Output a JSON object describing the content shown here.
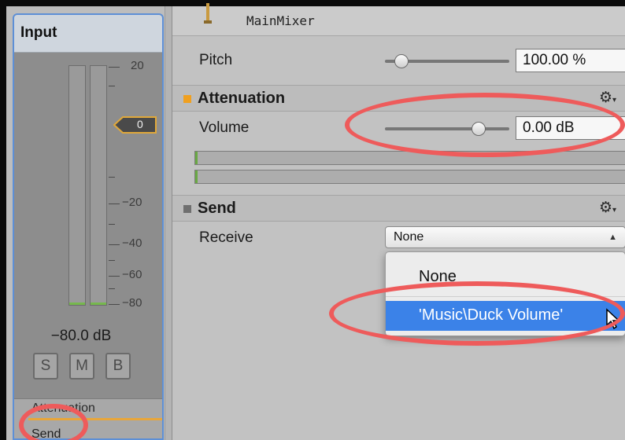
{
  "strip": {
    "title": "Input",
    "scale_labels": [
      "20",
      "0",
      "−20",
      "−40",
      "−60",
      "−80"
    ],
    "fader_value": "0",
    "db_readout": "−80.0 dB",
    "buttons": [
      "S",
      "M",
      "B"
    ],
    "effects": [
      "Attenuation",
      "Send"
    ],
    "meter_level_fraction": 0.0
  },
  "inspector": {
    "mixer_name": "MainMixer",
    "pitch": {
      "label": "Pitch",
      "value": "100.00 %"
    },
    "attenuation": {
      "title": "Attenuation",
      "volume_label": "Volume",
      "volume_value": "0.00 dB",
      "gear_icon": "gear-dropdown-icon"
    },
    "send": {
      "title": "Send",
      "receive_label": "Receive",
      "receive_value": "None",
      "gear_icon": "gear-dropdown-icon",
      "menu_items": [
        "None",
        "'Music\\Duck Volume'"
      ],
      "highlighted_index": 1
    }
  },
  "colors": {
    "annotation": "#ee5b5b",
    "attenuation_accent": "#f0a020",
    "send_accent": "#2db7c3",
    "selection": "#3b82e8",
    "meter_fill": "#76b84d"
  }
}
